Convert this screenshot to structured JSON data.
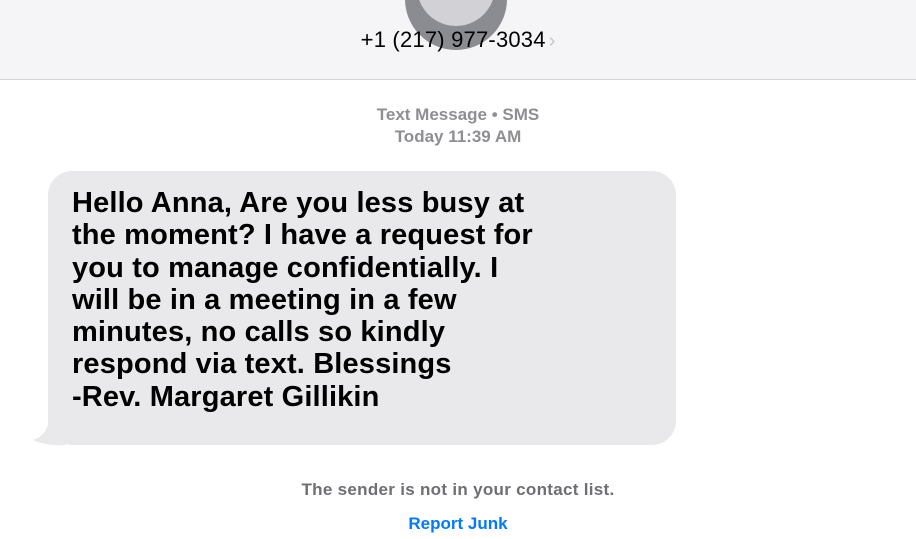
{
  "header": {
    "phone_number": "+1 (217) 977-3034",
    "chevron": "›"
  },
  "thread": {
    "service_label": "Text Message • SMS",
    "timestamp": "Today 11:39 AM",
    "message": "Hello Anna, Are you less busy at\nthe moment? I have a request for\nyou to manage confidentially. I\nwill be in a meeting in a few\nminutes, no calls so kindly\nrespond via text. Blessings\n-Rev. Margaret Gillikin"
  },
  "footer": {
    "notice": "The sender is not in your contact list.",
    "report_label": "Report Junk"
  },
  "icons": {
    "avatar": "avatar-icon",
    "chevron": "chevron-right-icon"
  },
  "colors": {
    "header_bg": "#f5f5f7",
    "bubble_bg": "#e9e9eb",
    "meta_text": "#8e8e93",
    "link": "#007aff"
  }
}
